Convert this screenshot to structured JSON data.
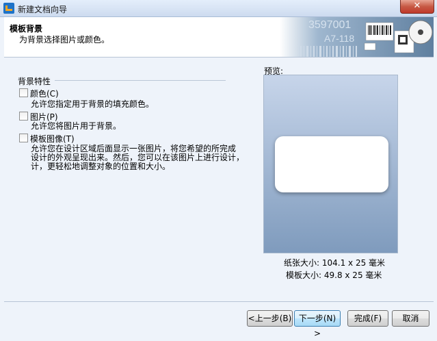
{
  "window": {
    "title": "新建文档向导",
    "close_label": "✕"
  },
  "header": {
    "title": "模板背景",
    "subtitle": "为背景选择图片或颜色。",
    "art_text_1": "3597001",
    "art_text_2": "A7-118"
  },
  "group": {
    "label": "背景特性"
  },
  "options": [
    {
      "label": "颜色(C)",
      "checked": false,
      "description": "允许您指定用于背景的填充颜色。"
    },
    {
      "label": "图片(P)",
      "checked": false,
      "description": "允许您将图片用于背景。"
    },
    {
      "label": "模板图像(T)",
      "checked": false,
      "description": "允许您在设计区域后面显示一张图片，将您希望的所完成\n设计的外观呈现出来。然后，您可以在该图片上进行设计，\n计，更轻松地调整对象的位置和大小。"
    }
  ],
  "preview": {
    "label": "预览:",
    "paper_size": "纸张大小: 104.1 x 25 毫米",
    "template_size": "模板大小: 49.8 x 25 毫米"
  },
  "buttons": {
    "back": "<上一步(B)",
    "next": "下一步(N) >",
    "finish": "完成(F)",
    "cancel": "取消"
  },
  "colors": {
    "accent": "#3c7fb1",
    "close": "#c75a45"
  }
}
